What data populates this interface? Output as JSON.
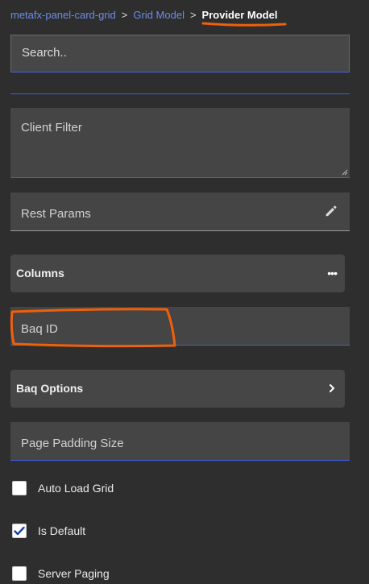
{
  "breadcrumb": {
    "items": [
      "metafx-panel-card-grid",
      "Grid Model"
    ],
    "separator": ">",
    "current": "Provider Model"
  },
  "search": {
    "placeholder": "Search.."
  },
  "fields": {
    "client_filter": "Client Filter",
    "rest_params": "Rest Params",
    "baq_id": "Baq ID",
    "page_padding_size": "Page Padding Size"
  },
  "sections": {
    "columns": {
      "title": "Columns",
      "menu_icon": "more-horizontal-icon"
    },
    "baq_options": {
      "title": "Baq Options",
      "icon": "chevron-right-icon"
    }
  },
  "checkboxes": [
    {
      "label": "Auto Load Grid",
      "checked": false
    },
    {
      "label": "Is Default",
      "checked": true
    },
    {
      "label": "Server Paging",
      "checked": false
    }
  ],
  "colors": {
    "background": "#2e2e2e",
    "field": "#454545",
    "accent": "#3f5ed6",
    "link": "#6b8ee8",
    "annotation": "#f0600a",
    "checkmark": "#1f3fb0"
  }
}
